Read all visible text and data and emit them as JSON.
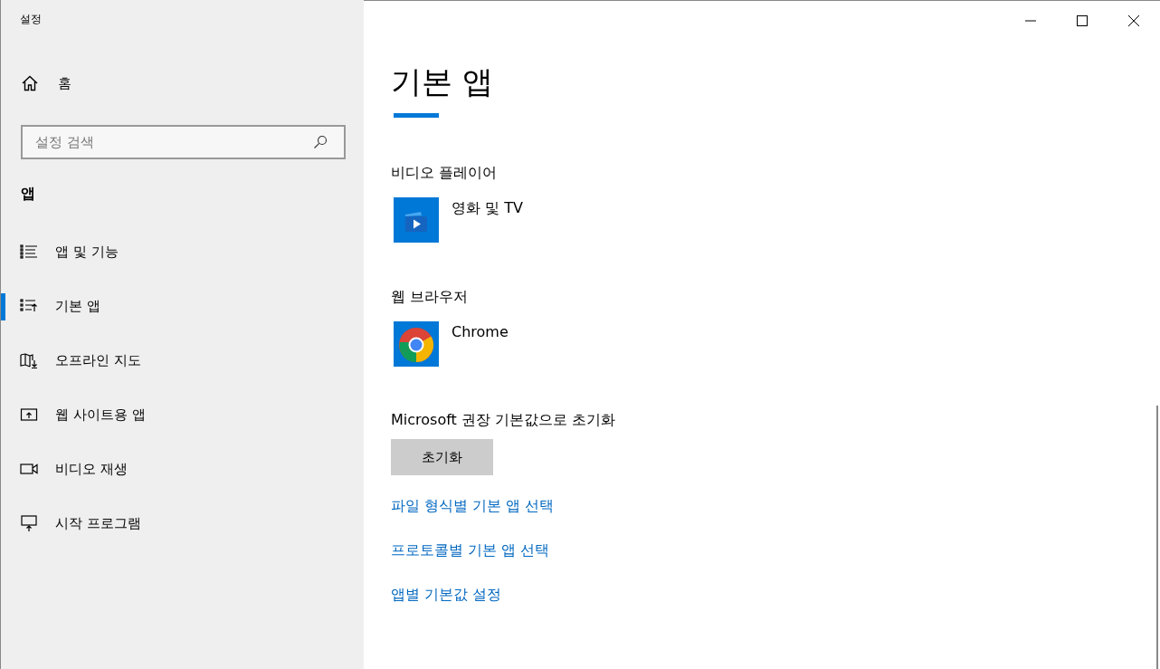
{
  "window": {
    "title": "설정"
  },
  "sidebar": {
    "home": "홈",
    "search": {
      "placeholder": "설정 검색"
    },
    "section": "앱",
    "items": [
      {
        "label": "앱 및 기능",
        "kind": "list",
        "selected": false
      },
      {
        "label": "기본 앱",
        "kind": "default",
        "selected": true
      },
      {
        "label": "오프라인 지도",
        "kind": "map",
        "selected": false
      },
      {
        "label": "웹 사이트용 앱",
        "kind": "web",
        "selected": false
      },
      {
        "label": "비디오 재생",
        "kind": "video",
        "selected": false
      },
      {
        "label": "시작 프로그램",
        "kind": "startup",
        "selected": false
      }
    ]
  },
  "main": {
    "title": "기본 앱",
    "defaults": [
      {
        "heading": "비디오 플레이어",
        "app": "영화 및 TV",
        "kind": "movies"
      },
      {
        "heading": "웹 브라우저",
        "app": "Chrome",
        "kind": "chrome"
      }
    ],
    "reset": {
      "label": "Microsoft 권장 기본값으로 초기화",
      "button": "초기화"
    },
    "links": [
      "파일 형식별 기본 앱 선택",
      "프로토콜별 기본 앱 선택",
      "앱별 기본값 설정"
    ]
  }
}
